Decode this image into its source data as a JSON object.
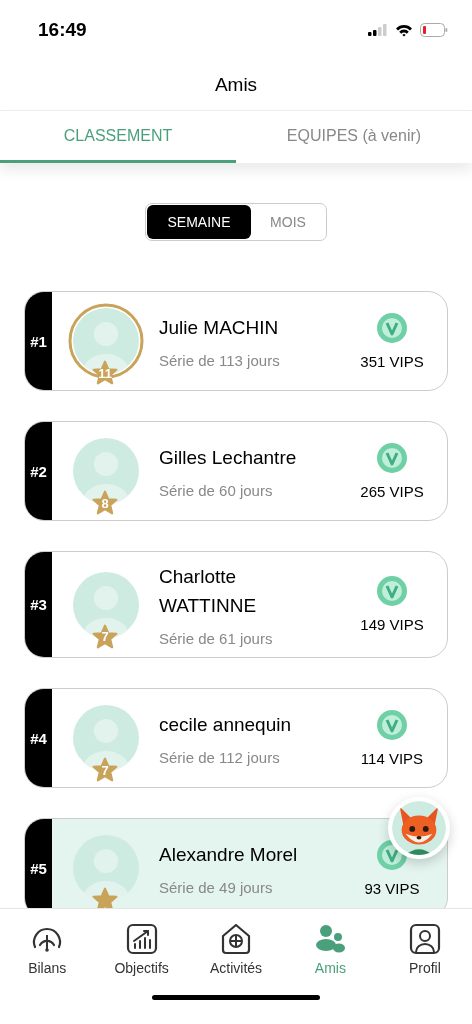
{
  "status_bar": {
    "time": "16:49"
  },
  "header": {
    "title": "Amis"
  },
  "tabs": [
    {
      "label": "CLASSEMENT",
      "selected": true
    },
    {
      "label": "EQUIPES (à venir)",
      "selected": false
    }
  ],
  "period": [
    {
      "label": "SEMAINE",
      "selected": true
    },
    {
      "label": "MOIS",
      "selected": false
    }
  ],
  "ranking": [
    {
      "rank": "#1",
      "name": "Julie MACHIN",
      "streak": "Série de 113 jours",
      "badge": "11",
      "vips": "351 VIPS",
      "ring": true,
      "highlighted": false
    },
    {
      "rank": "#2",
      "name": "Gilles Lechantre",
      "streak": "Série de 60 jours",
      "badge": "8",
      "vips": "265 VIPS",
      "ring": false,
      "highlighted": false
    },
    {
      "rank": "#3",
      "name": "Charlotte WATTINNE",
      "streak": "Série de 61 jours",
      "badge": "7",
      "vips": "149 VIPS",
      "ring": false,
      "highlighted": false
    },
    {
      "rank": "#4",
      "name": "cecile annequin",
      "streak": "Série de 112 jours",
      "badge": "7",
      "vips": "114 VIPS",
      "ring": false,
      "highlighted": false
    },
    {
      "rank": "#5",
      "name": "Alexandre Morel",
      "streak": "Série de 49 jours",
      "vips": "93 VIPS",
      "ring": false,
      "highlighted": true
    }
  ],
  "nav": [
    {
      "label": "Bilans",
      "selected": false
    },
    {
      "label": "Objectifs",
      "selected": false
    },
    {
      "label": "Activités",
      "selected": false
    },
    {
      "label": "Amis",
      "selected": true
    },
    {
      "label": "Profil",
      "selected": false
    }
  ]
}
